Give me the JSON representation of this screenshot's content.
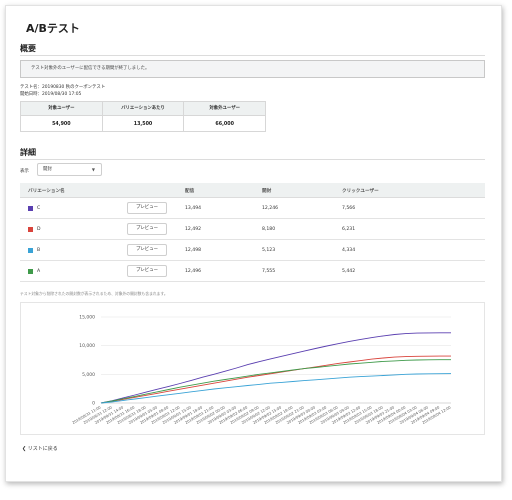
{
  "page": {
    "title": "A/Bテスト"
  },
  "overview": {
    "title": "概要",
    "notice": "テスト対象外のユーザーに配信できる期間が終了しました。",
    "test_name": "テスト名：20190830 秋のクーポンテスト",
    "start_date": "開始日時：2019/08/30 17:05",
    "summary": [
      {
        "label": "対象ユーザー",
        "value": "54,900"
      },
      {
        "label": "バリエーションあたり",
        "value": "13,500"
      },
      {
        "label": "対象外ユーザー",
        "value": "66,000"
      }
    ]
  },
  "details": {
    "title": "詳細",
    "filter_label": "表示",
    "filter_value": "開封",
    "table": {
      "headers": [
        "バリエーション名",
        "配信",
        "開封",
        "クリックユーザー"
      ],
      "preview_label": "プレビュー",
      "rows": [
        {
          "name": "C",
          "color": "#5a3fb0",
          "sent": "13,494",
          "opened": "12,246",
          "clicked": "7,566"
        },
        {
          "name": "D",
          "color": "#d9443c",
          "sent": "12,492",
          "opened": "8,180",
          "clicked": "6,231"
        },
        {
          "name": "B",
          "color": "#3aa3d6",
          "sent": "12,498",
          "opened": "5,123",
          "clicked": "4,334"
        },
        {
          "name": "A",
          "color": "#3f9a4a",
          "sent": "12,496",
          "opened": "7,555",
          "clicked": "5,442"
        }
      ]
    },
    "footnote": "テスト対象から削除されたの開封数が表示されるため、対象外の開封数も含まれます。"
  },
  "chart_data": {
    "type": "line",
    "title": "",
    "xlabel": "",
    "ylabel": "",
    "ylim": [
      0,
      15000
    ],
    "yticks": [
      "0",
      "5,000",
      "10,000",
      "15,000"
    ],
    "grid": true,
    "x": [
      "2019/08/31 11:00",
      "2019/08/31 12:00",
      "2019/08/31 14:00",
      "2019/08/31 16:00",
      "2019/08/31 18:00",
      "2019/09/01 05:00",
      "2019/09/01 08:00",
      "2019/09/01 12:00",
      "2019/09/01 15:00",
      "2019/09/01 18:00",
      "2019/09/01 21:00",
      "2019/09/02 00:00",
      "2019/09/02 03:00",
      "2019/09/02 06:00",
      "2019/09/02 09:00",
      "2019/09/02 12:00",
      "2019/09/02 15:00",
      "2019/09/02 18:00",
      "2019/09/02 21:00",
      "2019/09/03 00:00",
      "2019/09/03 03:00",
      "2019/09/03 06:00",
      "2019/09/03 09:00",
      "2019/09/03 12:00",
      "2019/09/03 15:00",
      "2019/09/03 18:00",
      "2019/09/03 21:00",
      "2019/09/04 00:00",
      "2019/09/04 03:00",
      "2019/09/04 06:00",
      "2019/09/04 09:00",
      "2019/09/04 12:00"
    ],
    "series": [
      {
        "color": "#5a3fb0",
        "values": [
          0,
          400,
          900,
          1400,
          1900,
          2400,
          2900,
          3400,
          3950,
          4500,
          5000,
          5550,
          6100,
          6700,
          7200,
          7700,
          8150,
          8600,
          9050,
          9500,
          9950,
          10350,
          10750,
          11100,
          11400,
          11700,
          11950,
          12100,
          12200,
          12230,
          12240,
          12246
        ]
      },
      {
        "color": "#d9443c",
        "values": [
          0,
          300,
          650,
          1000,
          1350,
          1700,
          2050,
          2400,
          2750,
          3100,
          3450,
          3800,
          4150,
          4500,
          4800,
          5100,
          5400,
          5700,
          6000,
          6300,
          6600,
          6900,
          7150,
          7400,
          7650,
          7850,
          8000,
          8100,
          8150,
          8170,
          8178,
          8180
        ]
      },
      {
        "color": "#3f9a4a",
        "values": [
          0,
          350,
          750,
          1150,
          1550,
          1950,
          2350,
          2750,
          3100,
          3450,
          3800,
          4100,
          4400,
          4700,
          5000,
          5250,
          5500,
          5750,
          6000,
          6200,
          6400,
          6600,
          6800,
          6950,
          7100,
          7250,
          7350,
          7450,
          7500,
          7530,
          7550,
          7555
        ]
      },
      {
        "color": "#3aa3d6",
        "values": [
          0,
          200,
          450,
          700,
          950,
          1200,
          1450,
          1700,
          1950,
          2200,
          2450,
          2650,
          2850,
          3050,
          3250,
          3450,
          3600,
          3750,
          3900,
          4050,
          4200,
          4350,
          4500,
          4600,
          4700,
          4800,
          4900,
          5000,
          5050,
          5100,
          5115,
          5123
        ]
      }
    ]
  },
  "footer": {
    "back_label": "リストに戻る"
  }
}
